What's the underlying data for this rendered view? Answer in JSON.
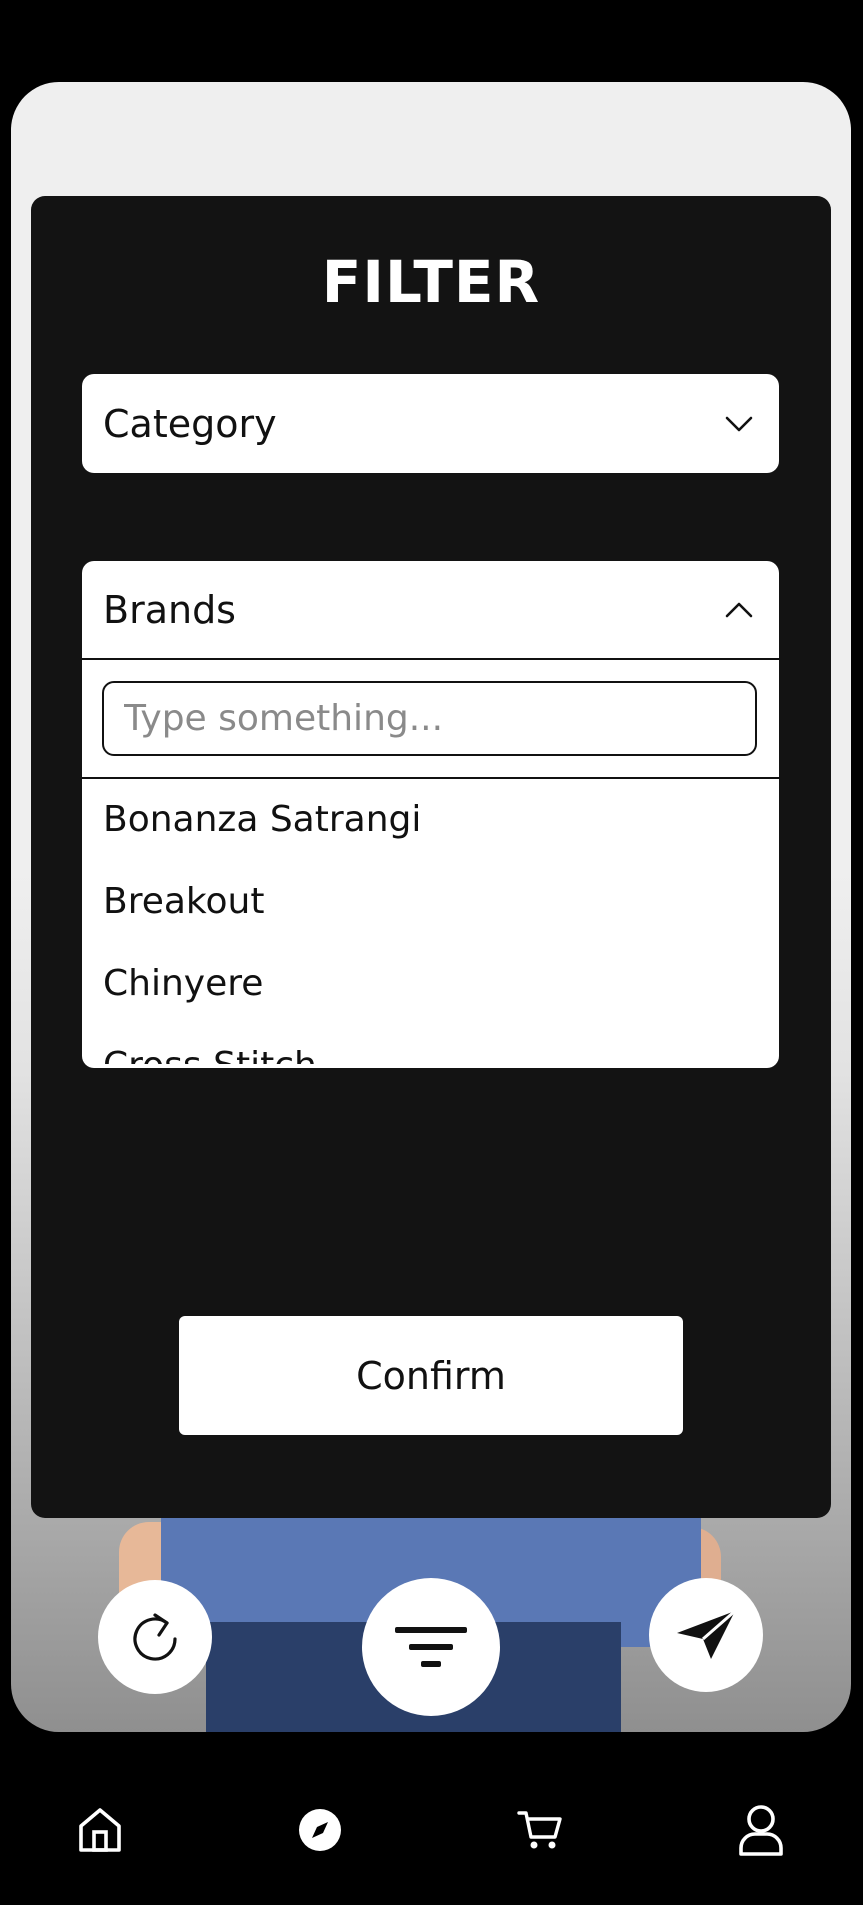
{
  "filter": {
    "title": "FILTER",
    "category": {
      "label": "Category",
      "expanded": false,
      "icon": "chevron-down-icon"
    },
    "brands": {
      "label": "Brands",
      "expanded": true,
      "icon": "chevron-up-icon",
      "search": {
        "placeholder": "Type something...",
        "value": ""
      },
      "items": [
        "Bonanza Satrangi",
        "Breakout",
        "Chinyere",
        "Cross Stitch"
      ]
    },
    "confirm_label": "Confirm"
  },
  "actions": {
    "refresh_icon": "refresh-icon",
    "filter_icon": "filter-icon",
    "send_icon": "send-icon"
  },
  "bottom_nav": {
    "items": [
      {
        "icon": "home-icon"
      },
      {
        "icon": "compass-icon"
      },
      {
        "icon": "cart-icon"
      },
      {
        "icon": "profile-icon"
      }
    ]
  },
  "colors": {
    "modal_background": "#131313",
    "surface": "#ffffff",
    "text": "#111111",
    "app_background": "#000000"
  }
}
